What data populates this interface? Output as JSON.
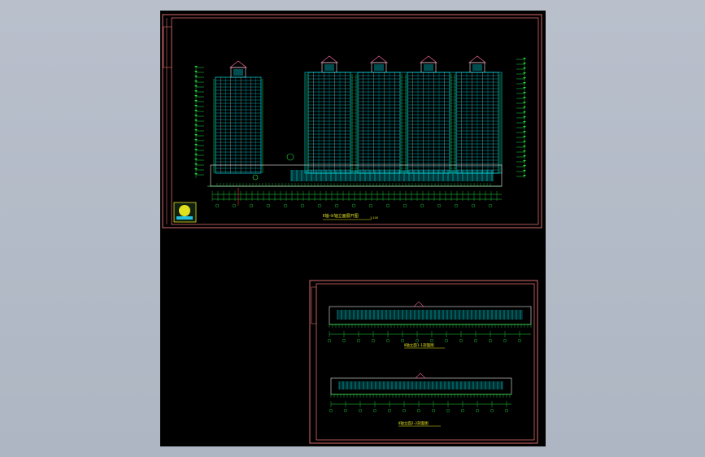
{
  "viewer": {
    "background": "#b5bcc8",
    "canvas_color": "#000000"
  },
  "colors": {
    "frame": "#d86a6a",
    "facade": "#00e0e8",
    "trim": "#e8e8e8",
    "dim": "#20e040",
    "accent": "#ff3030",
    "roof": "#e06090",
    "label": "#e0e020"
  },
  "sheet_main": {
    "title": "Ⅱ轴-⑩轴立面展开图",
    "scale": "1:100"
  },
  "sheet_sections": {
    "section_top_title": "Ⅱ轴立面1-1剖面图",
    "section_bottom_title": "Ⅱ轴立面2-2剖面图"
  }
}
